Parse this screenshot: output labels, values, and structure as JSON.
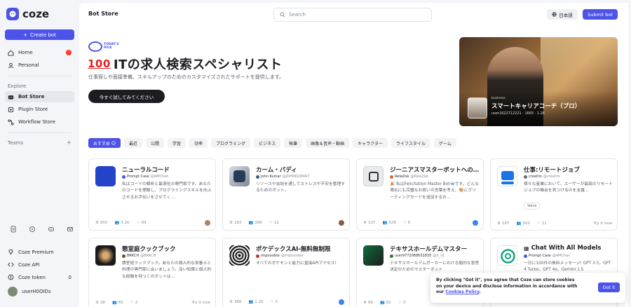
{
  "brand": {
    "name": "coze"
  },
  "sidebar": {
    "create_label": "Create bot",
    "nav": [
      {
        "label": "Home",
        "badge": "!"
      },
      {
        "label": "Personal"
      }
    ],
    "explore_label": "Explore",
    "explore": [
      {
        "label": "Bot Store"
      },
      {
        "label": "Plugin Store"
      },
      {
        "label": "Workflow Store"
      }
    ],
    "teams_label": "Teams",
    "bottom": [
      {
        "label": "Coze Premium"
      },
      {
        "label": "Coze API"
      },
      {
        "label": "Coze token",
        "count": "0"
      },
      {
        "label": "userH0OIDs"
      }
    ]
  },
  "header": {
    "title": "Bot Store",
    "search_placeholder": "Search",
    "lang_label": "日本語",
    "submit_label": "Submit bot"
  },
  "hero": {
    "pick_line1": "TODAY'S",
    "pick_line2": "PICK",
    "emoji": "100",
    "title": "ITの求人検索スペシャリスト",
    "desc": "仕事探しや面接準備、スキルアップのためのカスタマイズされたサポートを提供します。",
    "cta": "今すぐ試してみてください",
    "card": {
      "tag": "business",
      "title": "スマートキャリアコーチ（プロ）",
      "meta": "user1622712221 · 1665  ·  1.2K"
    }
  },
  "categories": [
    "おすすめ",
    "最近",
    "公開",
    "学習",
    "効率",
    "プログラミング",
    "ビジネス",
    "執筆",
    "画像＆音声・動画",
    "キャラクター",
    "ライフスタイル",
    "ゲーム"
  ],
  "cards": [
    {
      "title": "ニューラルコード",
      "author": "Prompt Case",
      "handle": "@AMChan",
      "desc": "私はコードの解析と最適化の専門家です。あなたのコードを理解し、プログラミングスキルを向上させるお手伝いをさせてく…",
      "runs": "650",
      "users": "3.1K",
      "likes": "69",
      "chip": "",
      "try": ""
    },
    {
      "title": "カーム・バディ",
      "author": "John Kumar",
      "handle": "@JOHNKUMAR7",
      "desc": "リソースや会話を通してストレスや不安を管理するためのボット。",
      "runs": "183",
      "users": "396",
      "likes": "12",
      "chip": "",
      "try": ""
    },
    {
      "title": "ジーニアスマスターボットへの…",
      "author": "ReleZoe",
      "handle": "@ReleZoe",
      "desc": "🎉 私はFelicitation Master Bot🐳です。どんな場合にも完璧なお祝いの言葉を考え、🎨にグリーティングカードを追加するお…",
      "runs": "137",
      "users": "328",
      "likes": "6",
      "chip": "",
      "try": ""
    },
    {
      "title": "仕事:リモートジョブ",
      "author": "creatris",
      "handle": "@creatris",
      "desc": "様々な産業において、ユーザーが最高のリモートジョブの機会を見つけるのを支援…",
      "runs": "197",
      "users": "303",
      "likes": "11",
      "chip": "Voice",
      "try": "Try it now"
    },
    {
      "title": "懇室庭クックブック",
      "author": "BRKCH",
      "handle": "@BRKCH",
      "desc": "懇室庭クックブック。あなたの個人的な栄養士と料理の専門家に会いましょう。深い知識と個人的な経験を持つこのボットは…",
      "runs": "38",
      "users": "65",
      "likes": "2",
      "chip": "",
      "try": "Try it now"
    },
    {
      "title": "ポケデックスAI-無料無制限",
      "author": "impossible",
      "handle": "@impossible",
      "desc": "すべてのポケモンと能力に直接APIアクセス!",
      "runs": "388",
      "users": "1.2K",
      "likes": "5",
      "chip": "",
      "try": ""
    },
    {
      "title": "テキサスホールデムマスター",
      "author": "user9772068631835",
      "handle": "@X_UJ",
      "desc": "テキサスホールデムポーカーにおける動的な意思決定のためのマスターボット",
      "runs": "89",
      "users": "82",
      "likes": "3",
      "chip": "",
      "try": ""
    },
    {
      "title": "Chat With All Models",
      "author": "Prompt Case",
      "handle": "@AMChan",
      "desc": "一日に100件の無料メッセージ! GPT 3.5、GPT 4 Turbo、GPT 4o、Gemini 1.5",
      "runs": "",
      "users": "",
      "likes": "",
      "chip": "",
      "try": ""
    }
  ],
  "cookie": {
    "text": "By clicking \"Got it\", you agree that Coze can store cookies on your device and disclose information in accordance with our",
    "link": "Cookies Policy",
    "button": "Got it"
  },
  "colors": {
    "accent": "#4d53e8",
    "sidebar_bg": "#f4f5f8",
    "text": "#1c1d23"
  }
}
